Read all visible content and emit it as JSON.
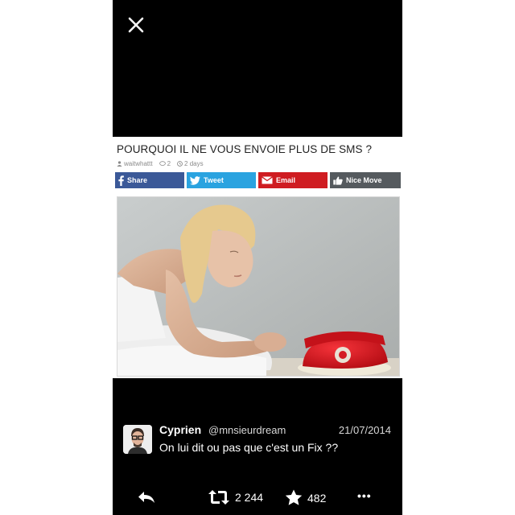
{
  "article": {
    "title": "POURQUOI IL NE VOUS ENVOIE PLUS DE SMS ?",
    "author": "waitwhattt",
    "comments": "2",
    "age": "2 days"
  },
  "share": {
    "facebook": "Share",
    "twitter": "Tweet",
    "email": "Email",
    "like": "Nice Move"
  },
  "tweet": {
    "name": "Cyprien",
    "handle": "@mnsieurdream",
    "date": "21/07/2014",
    "text": "On lui dit ou pas que c'est un Fix ??"
  },
  "actions": {
    "retweets": "2 244",
    "favorites": "482",
    "more": "•••"
  },
  "colors": {
    "facebook": "#3b5998",
    "twitter": "#2aa3e0",
    "email": "#cf1c21",
    "like": "#555a5e",
    "phone_red": "#d0141b"
  },
  "icons": [
    "close-icon",
    "user-icon",
    "comment-icon",
    "clock-icon",
    "facebook-icon",
    "twitter-bird-icon",
    "envelope-icon",
    "thumbs-up-icon",
    "reply-icon",
    "retweet-icon",
    "star-icon",
    "more-icon"
  ]
}
